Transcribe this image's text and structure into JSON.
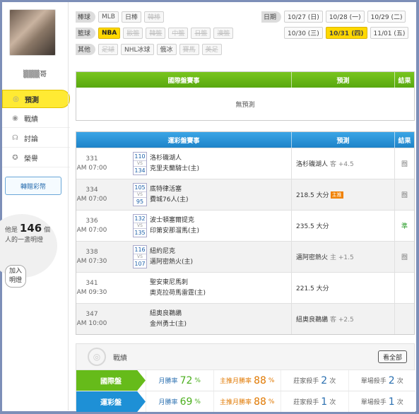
{
  "sidebar": {
    "user_name": "▒▒▒哥",
    "nav": [
      {
        "label": "預測",
        "icon": "target-icon",
        "glyph": "◎"
      },
      {
        "label": "戰績",
        "icon": "record-icon",
        "glyph": "◉"
      },
      {
        "label": "討論",
        "icon": "chat-icon",
        "glyph": "☊"
      },
      {
        "label": "榮譽",
        "icon": "award-icon",
        "glyph": "✪"
      }
    ],
    "gift_button": "轉贈彩幣",
    "bulb_prefix": "他是",
    "bulb_count": "146",
    "bulb_unit": "個",
    "bulb_line2": "人的一盞明燈",
    "join_button_l1": "加入",
    "join_button_l2": "明燈"
  },
  "filters": {
    "baseball": {
      "tag": "棒球",
      "items": [
        {
          "t": "MLB",
          "s": "n"
        },
        {
          "t": "日棒",
          "s": "n"
        },
        {
          "t": "韓棒",
          "s": "d"
        }
      ]
    },
    "basketball": {
      "tag": "籃球",
      "items": [
        {
          "t": "NBA",
          "s": "sel"
        },
        {
          "t": "歐籃",
          "s": "d"
        },
        {
          "t": "韓籃",
          "s": "d"
        },
        {
          "t": "中籃",
          "s": "d"
        },
        {
          "t": "日籃",
          "s": "d"
        },
        {
          "t": "澳籃",
          "s": "d"
        }
      ]
    },
    "other": {
      "tag": "其他",
      "items": [
        {
          "t": "足球",
          "s": "d"
        },
        {
          "t": "NHL冰球",
          "s": "n"
        },
        {
          "t": "俄冰",
          "s": "n"
        },
        {
          "t": "賽馬",
          "s": "d"
        },
        {
          "t": "美足",
          "s": "d"
        }
      ]
    }
  },
  "dates": {
    "tag": "日期",
    "row1": [
      {
        "t": "10/27 (日)",
        "s": "n"
      },
      {
        "t": "10/28 (一)",
        "s": "n"
      },
      {
        "t": "10/29 (二)",
        "s": "n"
      }
    ],
    "row2": [
      {
        "t": "10/30 (三)",
        "s": "n"
      },
      {
        "t": "10/31 (四)",
        "s": "sel"
      },
      {
        "t": "11/01 (五)",
        "s": "n"
      }
    ]
  },
  "intl": {
    "col_event": "國際盤賽事",
    "col_pred": "預測",
    "col_result": "結果",
    "empty": "無預測"
  },
  "lottery": {
    "col_event": "運彩盤賽事",
    "col_pred": "預測",
    "col_result": "結果",
    "games": [
      {
        "num": "331",
        "time": "AM 07:00",
        "s1": "110",
        "s2": "134",
        "t1": "洛杉磯湖人",
        "t2": "克里夫蘭騎士(主)",
        "pred": "洛杉磯湖人",
        "sub": "客 +4.5",
        "hot": "",
        "result": "囫",
        "rtype": "ico"
      },
      {
        "num": "334",
        "time": "AM 07:00",
        "s1": "105",
        "s2": "95",
        "t1": "底特律活塞",
        "t2": "費城76人(主)",
        "pred": "218.5 大分",
        "sub": "",
        "hot": "主推",
        "result": "囫",
        "rtype": "ico"
      },
      {
        "num": "336",
        "time": "AM 07:00",
        "s1": "132",
        "s2": "135",
        "t1": "波士頓塞爾提克",
        "t2": "印第安那溜馬(主)",
        "pred": "235.5 大分",
        "sub": "",
        "hot": "",
        "result": "準",
        "rtype": "win"
      },
      {
        "num": "338",
        "time": "AM 07:30",
        "s1": "116",
        "s2": "107",
        "t1": "紐約尼克",
        "t2": "邁阿密熱火(主)",
        "pred": "邁阿密熱火",
        "sub": "主 +1.5",
        "hot": "",
        "result": "囫",
        "rtype": "ico"
      },
      {
        "num": "341",
        "time": "AM 09:30",
        "s1": "",
        "s2": "",
        "t1": "聖安東尼馬刺",
        "t2": "奧克拉荷馬雷霆(主)",
        "pred": "221.5 大分",
        "sub": "",
        "hot": "",
        "result": "",
        "rtype": "ico"
      },
      {
        "num": "347",
        "time": "AM 10:00",
        "s1": "",
        "s2": "",
        "t1": "紐奧良鵜鶘",
        "t2": "金州勇士(主)",
        "pred": "紐奧良鵜鶘",
        "sub": "客 +2.5",
        "hot": "",
        "result": "",
        "rtype": "ico"
      }
    ]
  },
  "stats": {
    "title": "戰績",
    "view_all": "看全部",
    "rows": [
      {
        "label": "國際盤",
        "color": "#66bb1a",
        "rate_label": "月勝率",
        "rate": "72",
        "pct": "%",
        "main_label": "主推月勝率",
        "main_rate": "88",
        "pct2": "%",
        "zhuang_label": "莊家殺手",
        "zhuang": "2",
        "times": "次",
        "single_label": "單場殺手",
        "single": "2",
        "times2": "次"
      },
      {
        "label": "運彩盤",
        "color": "#1e90d6",
        "rate_label": "月勝率",
        "rate": "69",
        "pct": "%",
        "main_label": "主推月勝率",
        "main_rate": "88",
        "pct2": "%",
        "zhuang_label": "莊家殺手",
        "zhuang": "1",
        "times": "次",
        "single_label": "單場殺手",
        "single": "1",
        "times2": "次"
      }
    ]
  }
}
